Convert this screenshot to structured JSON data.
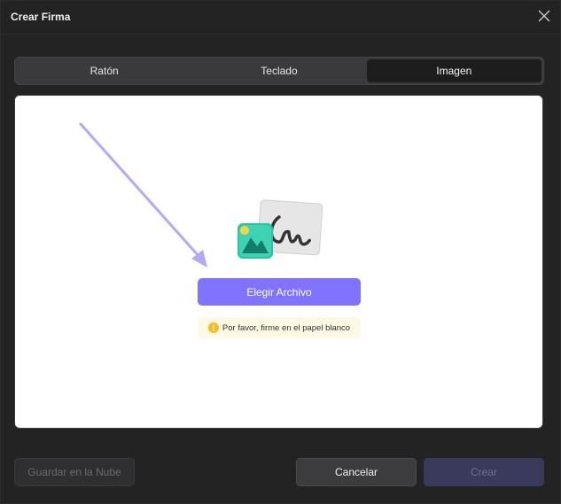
{
  "dialog": {
    "title": "Crear Firma",
    "close_icon": "close-icon"
  },
  "tabs": [
    {
      "label": "Ratón",
      "active": false
    },
    {
      "label": "Teclado",
      "active": false
    },
    {
      "label": "Imagen",
      "active": true
    }
  ],
  "canvas": {
    "choose_file_label": "Elegir Archivo",
    "hint_text": "Por favor, firme en el papel blanco",
    "hint_icon": "warning-icon",
    "illustration_icon": "signature-image-icon",
    "arrow_icon": "arrow-down-right-icon"
  },
  "footer": {
    "save_cloud_label": "Guardar en la Nube",
    "cancel_label": "Cancelar",
    "create_label": "Crear"
  },
  "colors": {
    "accent": "#7f73ff",
    "background": "#232324",
    "hint_background": "#fff8e4",
    "arrow": "#b3a9f7"
  }
}
